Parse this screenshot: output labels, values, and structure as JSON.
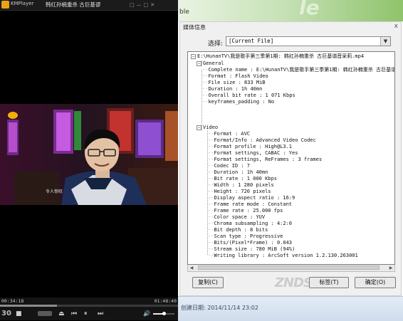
{
  "player": {
    "app_name": "KMPlayer",
    "file_title": "韩红孙楠重杀 古巨基谬",
    "window_controls": [
      "□",
      "—",
      "□",
      "✕"
    ],
    "subtitle_text": "令人惊叹",
    "time_elapsed": "00:34:18",
    "time_total": "01:48:40",
    "seek_progress": 0.32,
    "volume_level": 0.5,
    "controls": {
      "speed_label": "30",
      "stop": "■",
      "eject": "⏏",
      "prev": "⏮",
      "pause": "⏸",
      "next": "⏭",
      "volume": "🔊"
    }
  },
  "window": {
    "title_fragment": "ble",
    "deco_text": "le"
  },
  "dialog": {
    "title": "媒体信息",
    "close_glyph": "x",
    "select_label": "选择:",
    "select_value": "[Current File]",
    "tree": {
      "root": "E:\\HunanTV\\我是歌手第三季第1期: 韩红孙楠重杀 古巨基谐音采莉.mp4",
      "general_label": "General",
      "general_items": [
        "Complete name : E:\\HunanTV\\我是歌手第三季第1期: 韩红孙楠重杀 古巨基谐",
        "Format : Flash Video",
        "File size : 833 MiB",
        "Duration : 1h 40mn",
        "Overall bit rate : 1 071 Kbps",
        "keyframes_padding : No"
      ],
      "video_label": "Video",
      "video_items": [
        "Format : AVC",
        "Format/Info : Advanced Video Codec",
        "Format profile : High@L3.1",
        "Format settings, CABAC : Yes",
        "Format settings, ReFrames : 3 frames",
        "Codec ID : 7",
        "Duration : 1h 40mn",
        "Bit rate : 1 000 Kbps",
        "Width : 1 280 pixels",
        "Height : 720 pixels",
        "Display aspect ratio : 16:9",
        "Frame rate mode : Constant",
        "Frame rate : 25.000 fps",
        "Color space : YUV",
        "Chroma subsampling : 4:2:0",
        "Bit depth : 8 bits",
        "Scan type : Progressive",
        "Bits/(Pixel*Frame) : 0.043",
        "Stream size : 780 MiB (94%)",
        "Writing library : ArcSoft version 1.2.130.263001"
      ]
    },
    "scroll_left": "◀",
    "scroll_right": "▶",
    "buttons": {
      "copy": "复制(C)",
      "tag": "标签(T)",
      "ok": "确定(O)"
    },
    "watermark": "ZNDS"
  },
  "status": {
    "created": "创建日期: 2014/11/14 23:02"
  },
  "colors": {
    "player_bg": "#000000",
    "title_green": "#8fc36b",
    "dialog_bg": "#f0f0f0",
    "status_blue": "#d6e2f0"
  }
}
